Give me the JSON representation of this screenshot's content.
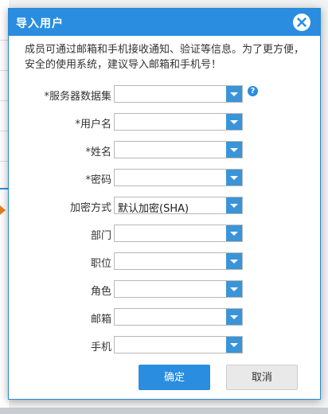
{
  "dialog": {
    "title": "导入用户",
    "notice": "成员可通过邮箱和手机接收通知、验证等信息。为了更方便，安全的使用系统，建议导入邮箱和手机号！",
    "confirm_label": "确定",
    "cancel_label": "取消",
    "help_glyph": "?",
    "fields": [
      {
        "label": "*服务器数据集",
        "value": ""
      },
      {
        "label": "*用户名",
        "value": ""
      },
      {
        "label": "*姓名",
        "value": ""
      },
      {
        "label": "*密码",
        "value": ""
      },
      {
        "label": "加密方式",
        "value": "默认加密(SHA)"
      },
      {
        "label": "部门",
        "value": ""
      },
      {
        "label": "职位",
        "value": ""
      },
      {
        "label": "角色",
        "value": ""
      },
      {
        "label": "邮箱",
        "value": ""
      },
      {
        "label": "手机",
        "value": ""
      }
    ]
  },
  "colors": {
    "accent": "#2a8de0",
    "dropdown_arrow": "#3a94d8",
    "cancel_bg": "#e9e9e9"
  },
  "icons": {
    "close": "close-icon",
    "help": "help-icon",
    "dropdown": "chevron-down-icon"
  }
}
